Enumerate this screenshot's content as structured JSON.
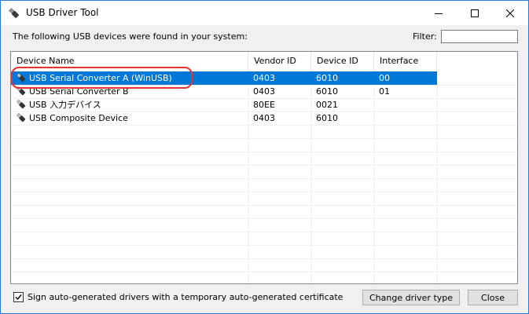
{
  "window": {
    "title": "USB Driver Tool"
  },
  "header": {
    "text": "The following USB devices were found in your system:",
    "filter_label": "Filter:",
    "filter_value": "",
    "filter_placeholder": ""
  },
  "table": {
    "columns": [
      "Device Name",
      "Vendor ID",
      "Device ID",
      "Interface"
    ],
    "rows": [
      {
        "name": "USB Serial Converter A (WinUSB)",
        "vendor": "0403",
        "device": "6010",
        "interface": "00",
        "selected": true,
        "highlighted": true
      },
      {
        "name": "USB Serial Converter B",
        "vendor": "0403",
        "device": "6010",
        "interface": "01",
        "selected": false
      },
      {
        "name": "USB 入力デバイス",
        "vendor": "80EE",
        "device": "0021",
        "interface": "",
        "selected": false
      },
      {
        "name": "USB Composite Device",
        "vendor": "0403",
        "device": "6010",
        "interface": "",
        "selected": false
      }
    ]
  },
  "footer": {
    "checkbox_label": "Sign auto-generated drivers with a temporary auto-generated certificate",
    "checkbox_checked": true,
    "change_button": "Change driver type",
    "close_button": "Close"
  },
  "icons": {
    "app": "usb-plug-icon",
    "row": "usb-plug-icon",
    "minimize": "minimize-icon",
    "maximize": "maximize-icon",
    "close": "close-icon"
  },
  "colors": {
    "selection": "#0078d7",
    "highlight_ring": "#e53333",
    "window_border": "#2b79d5"
  }
}
